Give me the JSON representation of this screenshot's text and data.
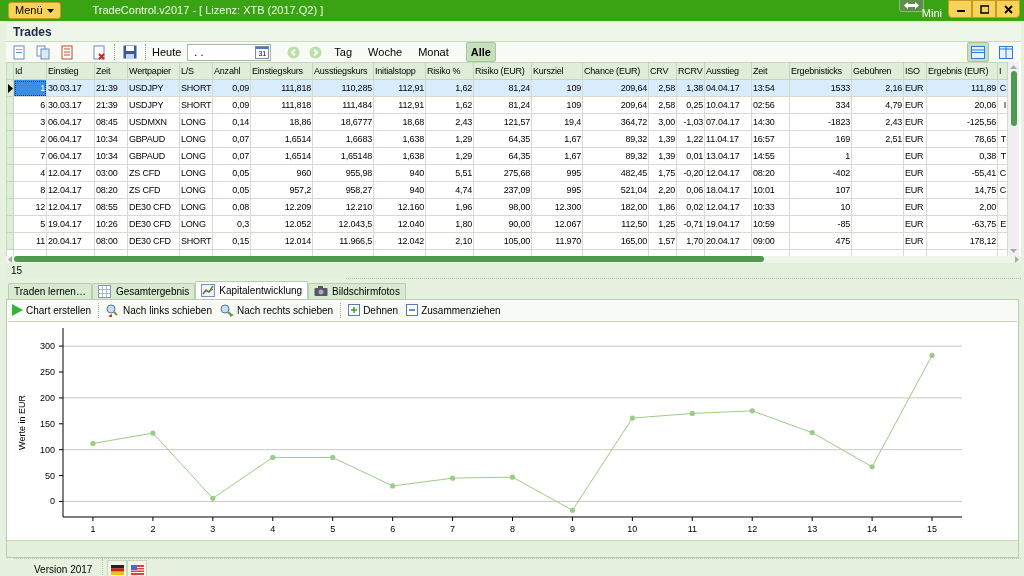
{
  "window": {
    "menu_button": "Menü",
    "title": "TradeControl.v2017 - [ Lizenz: XTB (2017.Q2) ]",
    "mini_label": "Mini"
  },
  "section_title": "Trades",
  "toolbar": {
    "today_label": "Heute",
    "date_value": ". .",
    "calendar_day": "31",
    "periods": [
      {
        "label": "Tag",
        "selected": false
      },
      {
        "label": "Woche",
        "selected": false
      },
      {
        "label": "Monat",
        "selected": false
      },
      {
        "label": "Alle",
        "selected": true
      }
    ],
    "layouts": [
      {
        "selected": true
      },
      {
        "selected": false
      }
    ]
  },
  "table": {
    "columns": [
      "Id",
      "Einstieg",
      "Zeit",
      "Wertpapier",
      "L/S",
      "Anzahl",
      "Einstiegskurs",
      "Ausstiegskurs",
      "Initialstopp",
      "Risiko %",
      "Risiko (EUR)",
      "Kursziel",
      "Chance (EUR)",
      "CRV",
      "RCRV",
      "Ausstieg",
      "Zeit",
      "Ergebnisticks",
      "Gebühren",
      "ISO",
      "Ergebnis (EUR)",
      "I"
    ],
    "rows": [
      {
        "selected": true,
        "cells": [
          "1",
          "30.03.17",
          "21:39",
          "USDJPY",
          "SHORT",
          "0,09",
          "111,818",
          "110,285",
          "112,91",
          "1,62",
          "81,24",
          "109",
          "209,64",
          "2,58",
          "1,38",
          "04.04.17",
          "13:54",
          "1533",
          "2,16",
          "EUR",
          "111,89",
          "C"
        ]
      },
      {
        "selected": false,
        "cells": [
          "6",
          "30.03.17",
          "21:39",
          "USDJPY",
          "SHORT",
          "0,09",
          "111,818",
          "111,484",
          "112,91",
          "1,62",
          "81,24",
          "109",
          "209,64",
          "2,58",
          "0,25",
          "10.04.17",
          "02:56",
          "334",
          "4,79",
          "EUR",
          "20,06",
          "I"
        ]
      },
      {
        "selected": false,
        "cells": [
          "3",
          "06.04.17",
          "08:45",
          "USDMXN",
          "LONG",
          "0,14",
          "18,86",
          "18,6777",
          "18,68",
          "2,43",
          "121,57",
          "19,4",
          "364,72",
          "3,00",
          "-1,03",
          "07.04.17",
          "14:30",
          "-1823",
          "2,43",
          "EUR",
          "-125,56",
          ""
        ]
      },
      {
        "selected": false,
        "cells": [
          "2",
          "06.04.17",
          "10:34",
          "GBPAUD",
          "LONG",
          "0,07",
          "1,6514",
          "1,6683",
          "1,638",
          "1,29",
          "64,35",
          "1,67",
          "89,32",
          "1,39",
          "1,22",
          "11.04.17",
          "16:57",
          "169",
          "2,51",
          "EUR",
          "78,65",
          "T"
        ]
      },
      {
        "selected": false,
        "cells": [
          "7",
          "06.04.17",
          "10:34",
          "GBPAUD",
          "LONG",
          "0,07",
          "1,6514",
          "1,65148",
          "1,638",
          "1,29",
          "64,35",
          "1,67",
          "89,32",
          "1,39",
          "0,01",
          "13.04.17",
          "14:55",
          "1",
          "",
          "EUR",
          "0,38",
          "T"
        ]
      },
      {
        "selected": false,
        "cells": [
          "4",
          "12.04.17",
          "03:00",
          "ZS CFD",
          "LONG",
          "0,05",
          "960",
          "955,98",
          "940",
          "5,51",
          "275,68",
          "995",
          "482,45",
          "1,75",
          "-0,20",
          "12.04.17",
          "08:20",
          "-402",
          "",
          "EUR",
          "-55,41",
          "C"
        ]
      },
      {
        "selected": false,
        "cells": [
          "8",
          "12.04.17",
          "08:20",
          "ZS CFD",
          "LONG",
          "0,05",
          "957,2",
          "958,27",
          "940",
          "4,74",
          "237,09",
          "995",
          "521,04",
          "2,20",
          "0,06",
          "18.04.17",
          "10:01",
          "107",
          "",
          "EUR",
          "14,75",
          "C"
        ]
      },
      {
        "selected": false,
        "cells": [
          "12",
          "12.04.17",
          "08:55",
          "DE30 CFD",
          "LONG",
          "0,08",
          "12.209",
          "12.210",
          "12.160",
          "1,96",
          "98,00",
          "12.300",
          "182,00",
          "1,86",
          "0,02",
          "12.04.17",
          "10:33",
          "10",
          "",
          "EUR",
          "2,00",
          ""
        ]
      },
      {
        "selected": false,
        "cells": [
          "5",
          "19.04.17",
          "10:26",
          "DE30 CFD",
          "LONG",
          "0,3",
          "12.052",
          "12.043,5",
          "12.040",
          "1,80",
          "90,00",
          "12.067",
          "112,50",
          "1,25",
          "-0,71",
          "19.04.17",
          "10:59",
          "-85",
          "",
          "EUR",
          "-63,75",
          "E"
        ]
      },
      {
        "selected": false,
        "cells": [
          "11",
          "20.04.17",
          "08:00",
          "DE30 CFD",
          "SHORT",
          "0,15",
          "12.014",
          "11.966,5",
          "12.042",
          "2,10",
          "105,00",
          "11.970",
          "165,00",
          "1,57",
          "1,70",
          "20.04.17",
          "09:00",
          "475",
          "",
          "EUR",
          "178,12",
          ""
        ]
      }
    ],
    "count": "15"
  },
  "tabs": [
    {
      "label": "Traden lernen…",
      "selected": false
    },
    {
      "label": "Gesamtergebnis",
      "selected": false
    },
    {
      "label": "Kapitalentwicklung",
      "selected": true
    },
    {
      "label": "Bildschirmfotos",
      "selected": false
    }
  ],
  "chart_toolbar": [
    "Chart erstellen",
    "Nach links schieben",
    "Nach rechts schieben",
    "Dehnen",
    "Zusammenziehen"
  ],
  "chart": {
    "chart_data": {
      "type": "line",
      "ylabel": "Werte in EUR",
      "x": [
        1,
        2,
        3,
        4,
        5,
        6,
        7,
        8,
        9,
        10,
        11,
        12,
        13,
        14,
        15
      ],
      "series": [
        {
          "color": "#9ccc84",
          "values": [
            112,
            132,
            6,
            85,
            85,
            30,
            45,
            47,
            -17,
            161,
            170,
            175,
            133,
            67,
            282
          ]
        }
      ],
      "grid": true,
      "xlim": [
        0.5,
        15.5
      ],
      "ylim": [
        -30,
        335
      ],
      "xticks": [
        1,
        2,
        3,
        4,
        5,
        6,
        7,
        8,
        9,
        10,
        11,
        12,
        13,
        14,
        15
      ],
      "yticks": [
        0,
        50,
        100,
        150,
        200,
        250,
        300
      ]
    }
  },
  "status_bar": {
    "version": "Version 2017"
  }
}
